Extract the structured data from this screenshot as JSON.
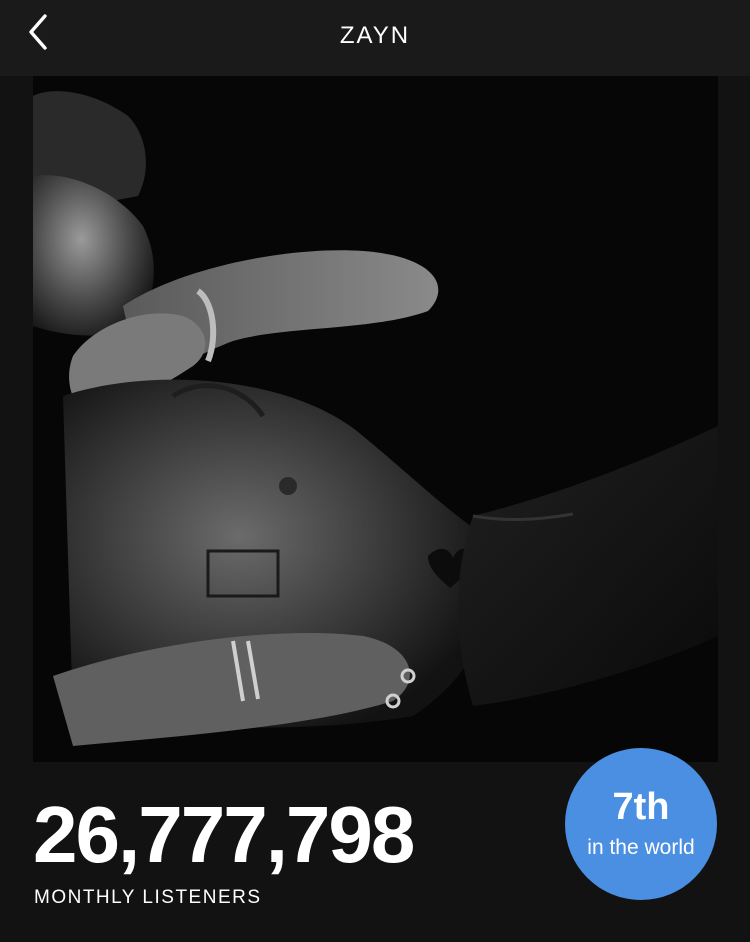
{
  "header": {
    "title": "ZAYN",
    "back_icon": "chevron-left-icon"
  },
  "artist_photo": {
    "style": "black-and-white portrait"
  },
  "stats": {
    "monthly_listeners": "26,777,798",
    "monthly_listeners_label": "MONTHLY LISTENERS"
  },
  "rank_badge": {
    "value": "7th",
    "caption": "in the world",
    "color": "#4a8fe2"
  },
  "colors": {
    "background": "#121212",
    "header_background": "#1a1a1a",
    "text": "#ffffff"
  }
}
